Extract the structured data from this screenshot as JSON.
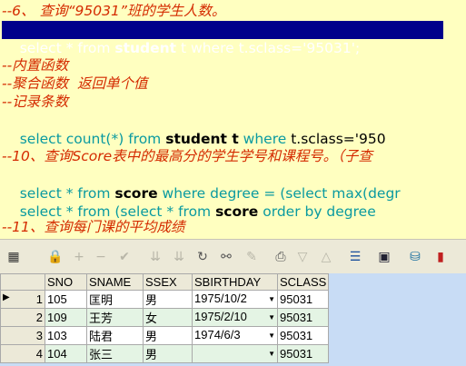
{
  "editor": {
    "line1": "--6、 查询“95031”班的学生人数。",
    "line2": {
      "a": "select * from ",
      "b": "student",
      "c": " t ",
      "d": "where",
      "e": " t.sclass='95031';"
    },
    "line3": "--内置函数",
    "line4": "--聚合函数  返回单个值",
    "line5": "--记录条数",
    "line6": {
      "a": "select ",
      "b": "count(*)",
      "c": " from ",
      "d": "student t",
      "e": " where ",
      "f": "t.sclass='950"
    },
    "line7": "--10、查询Score表中的最高分的学生学号和课程号。（子查",
    "line8": {
      "a": "select * from ",
      "b": "score",
      "c": " where degree = (select max(degr"
    },
    "line9": {
      "a": "select * from (select * from ",
      "b": "score",
      "c": " order by degree"
    },
    "line10": "--11、查询每门课的平均成绩"
  },
  "toolbar": {
    "icons": [
      "grid-icon",
      "lock-icon",
      "plus-icon",
      "minus-icon",
      "check-icon",
      "double-down-icon",
      "double-down-icon",
      "refresh-icon",
      "binoculars-icon",
      "eraser-icon",
      "print-icon",
      "triangle-down-icon",
      "triangle-up-icon",
      "columns-icon",
      "save-icon",
      "db-icon",
      "chart-icon"
    ]
  },
  "grid": {
    "columns": [
      "SNO",
      "SNAME",
      "SSEX",
      "SBIRTHDAY",
      "SCLASS"
    ],
    "rows": [
      {
        "n": "1",
        "sno": "105",
        "sname": "匡明",
        "ssex": "男",
        "sbirthday": "1975/10/2",
        "sclass": "95031"
      },
      {
        "n": "2",
        "sno": "109",
        "sname": "王芳",
        "ssex": "女",
        "sbirthday": "1975/2/10",
        "sclass": "95031"
      },
      {
        "n": "3",
        "sno": "103",
        "sname": "陆君",
        "ssex": "男",
        "sbirthday": "1974/6/3",
        "sclass": "95031"
      },
      {
        "n": "4",
        "sno": "104",
        "sname": "张三",
        "ssex": "男",
        "sbirthday": "",
        "sclass": "95031"
      }
    ]
  }
}
